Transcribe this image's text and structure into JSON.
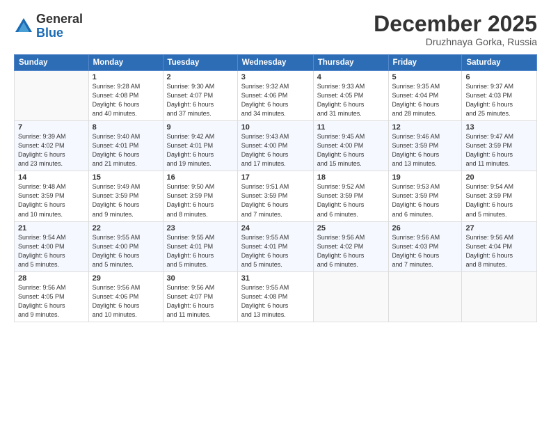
{
  "header": {
    "logo_general": "General",
    "logo_blue": "Blue",
    "month_title": "December 2025",
    "subtitle": "Druzhnaya Gorka, Russia"
  },
  "weekdays": [
    "Sunday",
    "Monday",
    "Tuesday",
    "Wednesday",
    "Thursday",
    "Friday",
    "Saturday"
  ],
  "weeks": [
    [
      {
        "day": "",
        "info": ""
      },
      {
        "day": "1",
        "info": "Sunrise: 9:28 AM\nSunset: 4:08 PM\nDaylight: 6 hours\nand 40 minutes."
      },
      {
        "day": "2",
        "info": "Sunrise: 9:30 AM\nSunset: 4:07 PM\nDaylight: 6 hours\nand 37 minutes."
      },
      {
        "day": "3",
        "info": "Sunrise: 9:32 AM\nSunset: 4:06 PM\nDaylight: 6 hours\nand 34 minutes."
      },
      {
        "day": "4",
        "info": "Sunrise: 9:33 AM\nSunset: 4:05 PM\nDaylight: 6 hours\nand 31 minutes."
      },
      {
        "day": "5",
        "info": "Sunrise: 9:35 AM\nSunset: 4:04 PM\nDaylight: 6 hours\nand 28 minutes."
      },
      {
        "day": "6",
        "info": "Sunrise: 9:37 AM\nSunset: 4:03 PM\nDaylight: 6 hours\nand 25 minutes."
      }
    ],
    [
      {
        "day": "7",
        "info": "Sunrise: 9:39 AM\nSunset: 4:02 PM\nDaylight: 6 hours\nand 23 minutes."
      },
      {
        "day": "8",
        "info": "Sunrise: 9:40 AM\nSunset: 4:01 PM\nDaylight: 6 hours\nand 21 minutes."
      },
      {
        "day": "9",
        "info": "Sunrise: 9:42 AM\nSunset: 4:01 PM\nDaylight: 6 hours\nand 19 minutes."
      },
      {
        "day": "10",
        "info": "Sunrise: 9:43 AM\nSunset: 4:00 PM\nDaylight: 6 hours\nand 17 minutes."
      },
      {
        "day": "11",
        "info": "Sunrise: 9:45 AM\nSunset: 4:00 PM\nDaylight: 6 hours\nand 15 minutes."
      },
      {
        "day": "12",
        "info": "Sunrise: 9:46 AM\nSunset: 3:59 PM\nDaylight: 6 hours\nand 13 minutes."
      },
      {
        "day": "13",
        "info": "Sunrise: 9:47 AM\nSunset: 3:59 PM\nDaylight: 6 hours\nand 11 minutes."
      }
    ],
    [
      {
        "day": "14",
        "info": "Sunrise: 9:48 AM\nSunset: 3:59 PM\nDaylight: 6 hours\nand 10 minutes."
      },
      {
        "day": "15",
        "info": "Sunrise: 9:49 AM\nSunset: 3:59 PM\nDaylight: 6 hours\nand 9 minutes."
      },
      {
        "day": "16",
        "info": "Sunrise: 9:50 AM\nSunset: 3:59 PM\nDaylight: 6 hours\nand 8 minutes."
      },
      {
        "day": "17",
        "info": "Sunrise: 9:51 AM\nSunset: 3:59 PM\nDaylight: 6 hours\nand 7 minutes."
      },
      {
        "day": "18",
        "info": "Sunrise: 9:52 AM\nSunset: 3:59 PM\nDaylight: 6 hours\nand 6 minutes."
      },
      {
        "day": "19",
        "info": "Sunrise: 9:53 AM\nSunset: 3:59 PM\nDaylight: 6 hours\nand 6 minutes."
      },
      {
        "day": "20",
        "info": "Sunrise: 9:54 AM\nSunset: 3:59 PM\nDaylight: 6 hours\nand 5 minutes."
      }
    ],
    [
      {
        "day": "21",
        "info": "Sunrise: 9:54 AM\nSunset: 4:00 PM\nDaylight: 6 hours\nand 5 minutes."
      },
      {
        "day": "22",
        "info": "Sunrise: 9:55 AM\nSunset: 4:00 PM\nDaylight: 6 hours\nand 5 minutes."
      },
      {
        "day": "23",
        "info": "Sunrise: 9:55 AM\nSunset: 4:01 PM\nDaylight: 6 hours\nand 5 minutes."
      },
      {
        "day": "24",
        "info": "Sunrise: 9:55 AM\nSunset: 4:01 PM\nDaylight: 6 hours\nand 5 minutes."
      },
      {
        "day": "25",
        "info": "Sunrise: 9:56 AM\nSunset: 4:02 PM\nDaylight: 6 hours\nand 6 minutes."
      },
      {
        "day": "26",
        "info": "Sunrise: 9:56 AM\nSunset: 4:03 PM\nDaylight: 6 hours\nand 7 minutes."
      },
      {
        "day": "27",
        "info": "Sunrise: 9:56 AM\nSunset: 4:04 PM\nDaylight: 6 hours\nand 8 minutes."
      }
    ],
    [
      {
        "day": "28",
        "info": "Sunrise: 9:56 AM\nSunset: 4:05 PM\nDaylight: 6 hours\nand 9 minutes."
      },
      {
        "day": "29",
        "info": "Sunrise: 9:56 AM\nSunset: 4:06 PM\nDaylight: 6 hours\nand 10 minutes."
      },
      {
        "day": "30",
        "info": "Sunrise: 9:56 AM\nSunset: 4:07 PM\nDaylight: 6 hours\nand 11 minutes."
      },
      {
        "day": "31",
        "info": "Sunrise: 9:55 AM\nSunset: 4:08 PM\nDaylight: 6 hours\nand 13 minutes."
      },
      {
        "day": "",
        "info": ""
      },
      {
        "day": "",
        "info": ""
      },
      {
        "day": "",
        "info": ""
      }
    ]
  ]
}
